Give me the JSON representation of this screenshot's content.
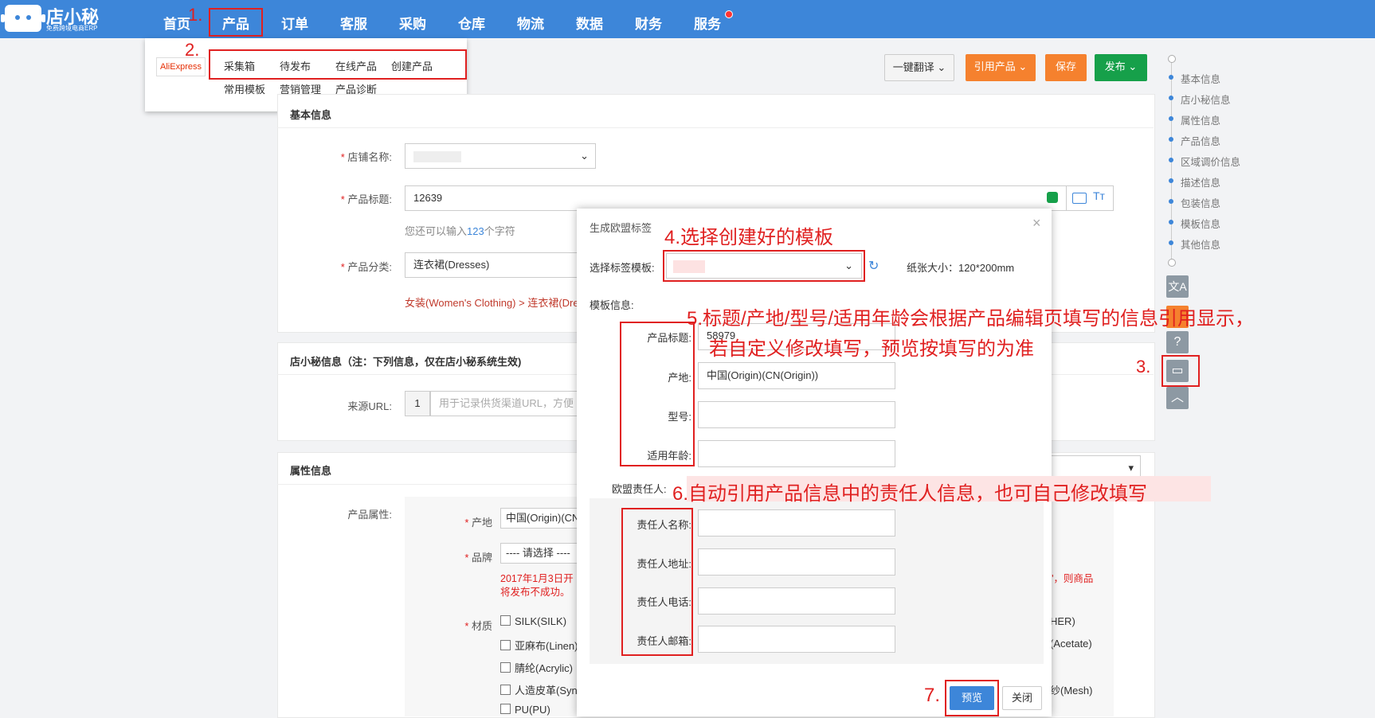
{
  "app": {
    "name": "店小秘",
    "subtitle": "免费跨境电商ERP"
  },
  "nav": {
    "items": [
      "首页",
      "产品",
      "订单",
      "客服",
      "采购",
      "仓库",
      "物流",
      "数据",
      "财务",
      "服务"
    ]
  },
  "dropdown": {
    "platform_logo": "AliExpress",
    "row1": [
      "采集箱",
      "待发布",
      "在线产品",
      "创建产品"
    ],
    "row2": [
      "常用模板",
      "营销管理",
      "产品诊断"
    ]
  },
  "toolbar": {
    "translate": "一键翻译",
    "quote": "引用产品",
    "save": "保存",
    "publish": "发布"
  },
  "right_nav": {
    "items": [
      "基本信息",
      "店小秘信息",
      "属性信息",
      "产品信息",
      "区域调价信息",
      "描述信息",
      "包装信息",
      "模板信息",
      "其他信息"
    ]
  },
  "basic": {
    "section_title": "基本信息",
    "shop_label": "店铺名称:",
    "title_label": "产品标题:",
    "title_value": "12639",
    "remaining_prefix": "您还可以输入",
    "remaining_count": "123",
    "remaining_suffix": "个字符",
    "category_label": "产品分类:",
    "category_value": "连衣裙(Dresses)",
    "category_path": "女装(Women's Clothing) > 连衣裙(Dre"
  },
  "dxm": {
    "section_title": "店小秘信息（注：下列信息，仅在店小秘系统生效)",
    "source_label": "来源URL:",
    "source_index": "1",
    "source_placeholder": "用于记录供货渠道URL，方便"
  },
  "attrs": {
    "section_title": "属性信息",
    "prop_label": "产品属性:",
    "origin_label": "产地",
    "origin_value": "中国(Origin)(CN",
    "brand_label": "品牌",
    "brand_value": "---- 请选择 ----",
    "warn_left_1": "2017年1月3日开",
    "warn_left_2": "将发布不成功。",
    "warn_right": "\"，则商品",
    "material_label": "材质",
    "materials_left": [
      "SILK(SILK)",
      "亚麻布(Linen)",
      "腈纶(Acrylic)",
      "人造皮革(Syn",
      "PU(PU)"
    ],
    "materials_right": [
      "HER)",
      "(Acetate)",
      "纱(Mesh)"
    ]
  },
  "dialog": {
    "title": "生成欧盟标签",
    "template_label": "选择标签模板:",
    "paper_size": "纸张大小：120*200mm",
    "template_info_label": "模板信息:",
    "fields": {
      "title_label": "产品标题:",
      "title_value": "58979",
      "origin_label": "产地:",
      "origin_value": "中国(Origin)(CN(Origin))",
      "model_label": "型号:",
      "age_label": "适用年龄:"
    },
    "responsible_label": "欧盟责任人:",
    "responsible": {
      "name_label": "责任人名称:",
      "addr_label": "责任人地址:",
      "phone_label": "责任人电话:",
      "email_label": "责任人邮箱:"
    },
    "preview_button": "预览",
    "close_button": "关闭"
  },
  "annotations": {
    "a1": "1.",
    "a2": "2.",
    "a3": "3.",
    "a4": "4.选择创建好的模板",
    "a5_line1": "5.标题/产地/型号/适用年龄会根据产品编辑页填写的信息引用显示，",
    "a5_line2": "若自定义修改填写，预览按填写的为准",
    "a6": "6.自动引用产品信息中的责任人信息，也可自己修改填写",
    "a7": "7."
  },
  "colors": {
    "primary": "#3d86d9",
    "orange": "#f5812e",
    "green": "#16a04a",
    "annotation": "#e02020"
  }
}
